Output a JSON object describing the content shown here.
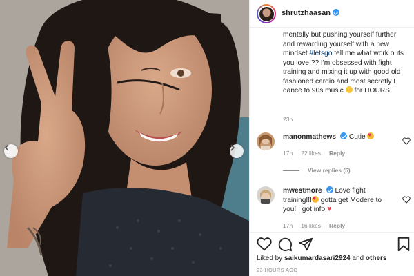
{
  "post": {
    "username": "shrutzhaasan",
    "caption_prefix": "mentally but pushing yourself further and rewarding yourself with a new mindset ",
    "hashtag": "#letsgo",
    "caption_suffix": " tell me what work outs you love ?? I'm obsessed with fight training and mixing it up with good old fashioned cardio and most secretly I dance to 90s music ",
    "caption_end": " for HOURS",
    "caption_time": "23h"
  },
  "comments": [
    {
      "username": "manonmathews",
      "text": "Cutie ",
      "time": "17h",
      "likes": "22 likes",
      "reply": "Reply"
    },
    {
      "username": "mwestmore",
      "text": "Love fight training!!!",
      "text_2": " gotta get Modere to you! I got info ",
      "time": "17h",
      "likes": "16 likes",
      "reply": "Reply"
    }
  ],
  "view_replies": "View replies (5)",
  "footer": {
    "liked_by_prefix": "Liked by ",
    "liked_by_user": "saikumardasari2924",
    "liked_by_middle": " and ",
    "liked_by_others": "others",
    "post_time": "23 HOURS AGO"
  },
  "colors": {
    "verified": "#3897f0",
    "hashtag": "#00376b",
    "like_red": "#ed4956"
  },
  "icons": [
    "chevron-left-icon",
    "chevron-right-icon",
    "heart-icon",
    "comment-icon",
    "share-icon",
    "bookmark-icon",
    "verified-badge-icon"
  ]
}
